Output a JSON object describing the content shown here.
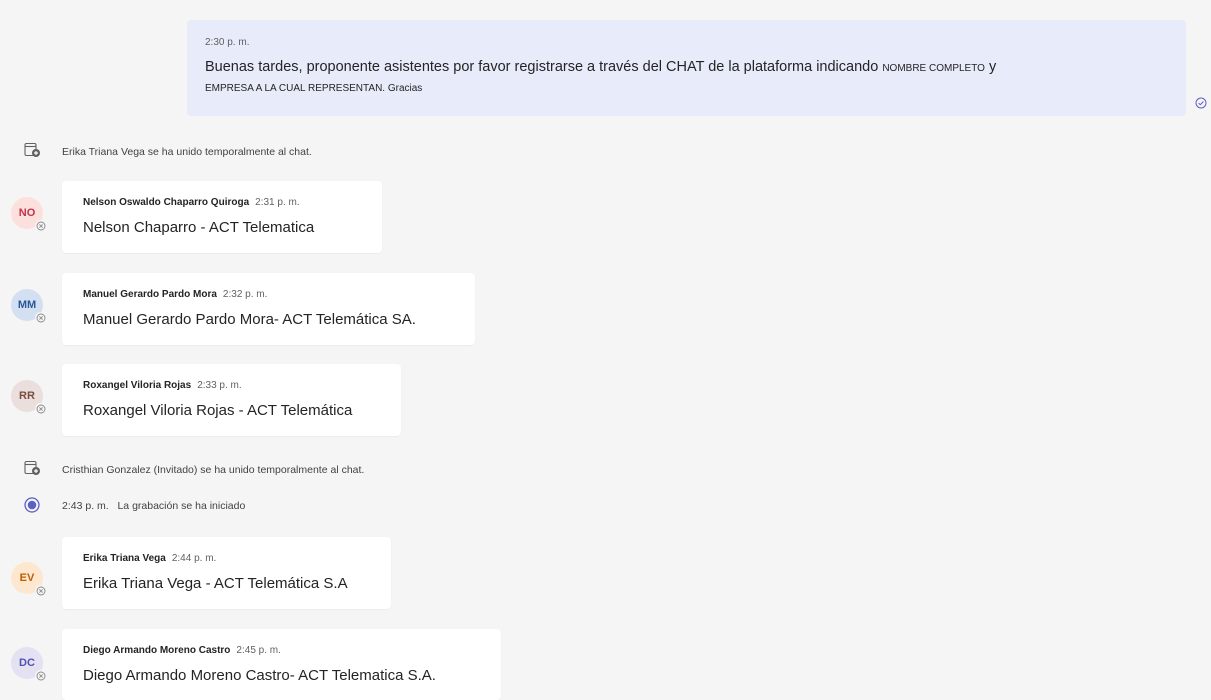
{
  "own_message": {
    "time": "2:30 p. m.",
    "text_a": "Buenas tardes, proponente asistentes por favor registrarse a través del CHAT de la plataforma indicando ",
    "text_small_a": "NOMBRE COMPLETO",
    "text_b": " y",
    "text_line2": "EMPRESA A LA CUAL REPRESENTAN. Gracias"
  },
  "events": {
    "join1": "Erika Triana Vega se ha unido temporalmente al chat.",
    "join2": "Cristhian Gonzalez (Invitado) se ha unido temporalmente al chat.",
    "recording_time": "2:43 p. m.",
    "recording_text": "La grabación se ha iniciado"
  },
  "messages": [
    {
      "initials": "NO",
      "name": "Nelson Oswaldo Chaparro Quiroga",
      "time": "2:31 p. m.",
      "text": "Nelson Chaparro - ACT Telematica"
    },
    {
      "initials": "MM",
      "name": "Manuel Gerardo Pardo Mora",
      "time": "2:32 p. m.",
      "text": "Manuel Gerardo Pardo Mora- ACT Telemática SA."
    },
    {
      "initials": "RR",
      "name": "Roxangel Viloria Rojas",
      "time": "2:33 p. m.",
      "text": "Roxangel Viloria Rojas - ACT Telemática"
    },
    {
      "initials": "EV",
      "name": "Erika Triana Vega",
      "time": "2:44 p. m.",
      "text": "Erika Triana Vega - ACT Telemática S.A"
    },
    {
      "initials": "DC",
      "name": "Diego Armando Moreno Castro",
      "time": "2:45 p. m.",
      "text": "Diego Armando Moreno Castro- ACT Telematica S.A."
    }
  ],
  "colors": {
    "own_bubble": "#e8ebfa",
    "accent": "#5b5fc7",
    "avatar_no": "#fbe0dc",
    "avatar_mm": "#d3e0f2",
    "avatar_rr": "#eadfdc",
    "avatar_ev": "#fde8cf",
    "avatar_dc": "#e4e2f2"
  },
  "icons": {
    "join": "chat-join-icon",
    "recording": "recording-icon",
    "seen": "seen-check-icon",
    "presence": "offline-presence-icon"
  }
}
